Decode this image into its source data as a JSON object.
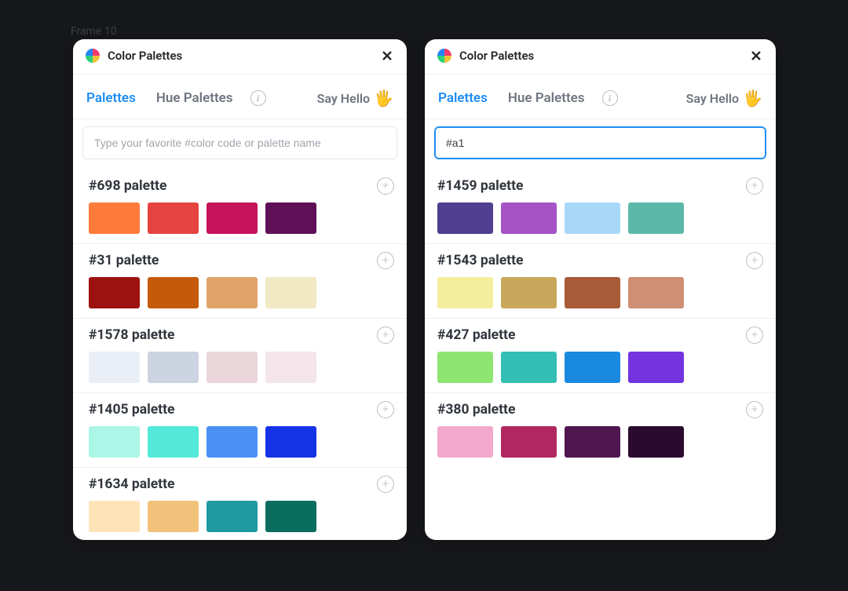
{
  "frame_label": "Frame 10",
  "panels": [
    {
      "title": "Color Palettes",
      "tabs": {
        "palettes": "Palettes",
        "hue": "Hue Palettes"
      },
      "say_hello": "Say Hello",
      "search": {
        "placeholder": "Type your favorite #color code or palette name",
        "value": "",
        "focused": false
      },
      "palettes": [
        {
          "name": "#698 palette",
          "colors": [
            "#ff7b3a",
            "#e44340",
            "#c6135c",
            "#5f0f56"
          ]
        },
        {
          "name": "#31 palette",
          "colors": [
            "#9d120f",
            "#c65a0b",
            "#e0a46b",
            "#f0e9c4"
          ]
        },
        {
          "name": "#1578 palette",
          "colors": [
            "#eaeef6",
            "#ccd3e1",
            "#ead5da",
            "#f3e5e9"
          ]
        },
        {
          "name": "#1405 palette",
          "colors": [
            "#abf6e6",
            "#52e9d9",
            "#4a90f5",
            "#1534e6"
          ]
        },
        {
          "name": "#1634 palette",
          "colors": [
            "#ffe3b8",
            "#f2c27b",
            "#2099a0",
            "#0b6d5f"
          ]
        }
      ]
    },
    {
      "title": "Color Palettes",
      "tabs": {
        "palettes": "Palettes",
        "hue": "Hue Palettes"
      },
      "say_hello": "Say Hello",
      "search": {
        "placeholder": "Type your favorite #color code or palette name",
        "value": "#a1",
        "focused": true
      },
      "palettes": [
        {
          "name": "#1459 palette",
          "colors": [
            "#503e8f",
            "#a454c7",
            "#a7d8f7",
            "#5bb8a9"
          ]
        },
        {
          "name": "#1543 palette",
          "colors": [
            "#f3ee9d",
            "#c8a85b",
            "#a85a39",
            "#cf8f73"
          ]
        },
        {
          "name": "#427 palette",
          "colors": [
            "#8fe572",
            "#34bfb4",
            "#1a8ae0",
            "#7334e0"
          ]
        },
        {
          "name": "#380 palette",
          "colors": [
            "#f2a9cd",
            "#b02761",
            "#4f1650",
            "#2c0a2f"
          ]
        }
      ]
    }
  ]
}
